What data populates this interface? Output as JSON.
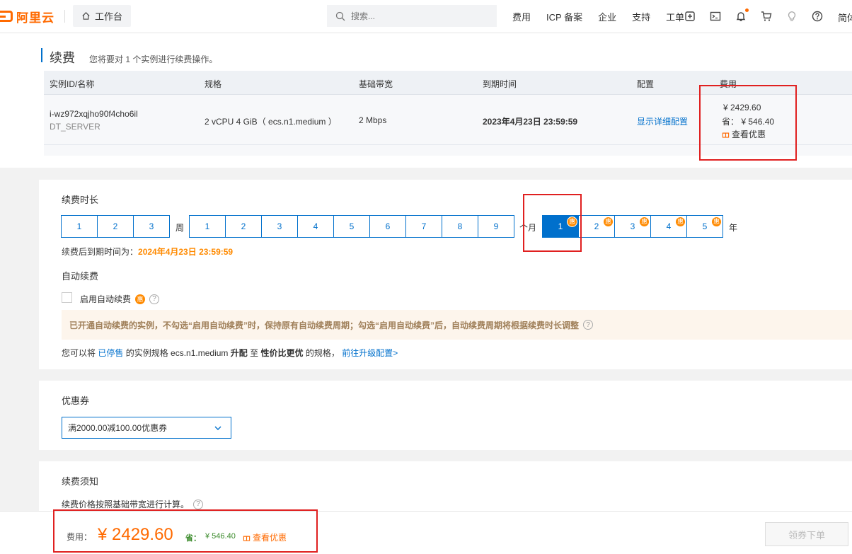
{
  "header": {
    "brand": "阿里云",
    "workbench": "工作台",
    "search_placeholder": "搜索...",
    "nav": [
      "费用",
      "ICP 备案",
      "企业",
      "支持",
      "工单"
    ],
    "trail": "简体"
  },
  "renew": {
    "title": "续费",
    "subtitle": "您将要对 1 个实例进行续费操作。",
    "columns": [
      "实例ID/名称",
      "规格",
      "基础带宽",
      "到期时间",
      "配置",
      "费用"
    ],
    "row": {
      "instance_id": "i-wz972xqjho90f4cho6il",
      "instance_name": "DT_SERVER",
      "spec": "2 vCPU 4 GiB（ ecs.n1.medium ）",
      "bandwidth": "2 Mbps",
      "expire": "2023年4月23日 23:59:59",
      "config_link": "显示详细配置",
      "fee": "¥ 2429.60",
      "save": "省：  ¥ 546.40",
      "discount_link": "查看优惠"
    }
  },
  "duration": {
    "title": "续费时长",
    "weeks": [
      "1",
      "2",
      "3"
    ],
    "week_unit": "周",
    "months": [
      "1",
      "2",
      "3",
      "4",
      "5",
      "6",
      "7",
      "8",
      "9"
    ],
    "month_unit": "个月",
    "years": [
      "1",
      "2",
      "3",
      "4",
      "5"
    ],
    "year_unit": "年",
    "selected": "年-1",
    "hui_badge": "惠",
    "expire_after_label": "续费后到期时间为：",
    "expire_after_value": "2024年4月23日 23:59:59"
  },
  "autorenew": {
    "title": "自动续费",
    "checkbox_label": "启用自动续费",
    "checked": false,
    "notice": "已开通自动续费的实例，不勾选“启用自动续费”时，保持原有自动续费周期；勾选“启用自动续费”后，自动续费周期将根据续费时长调整",
    "upgrade_p1": "您可以将",
    "upgrade_stopped": "已停售",
    "upgrade_p2": "的实例规格 ecs.n1.medium",
    "upgrade_bold1": "升配",
    "upgrade_p3": "至",
    "upgrade_bold2": "性价比更优",
    "upgrade_p4": "的规格，",
    "upgrade_link": "前往升级配置>"
  },
  "coupon": {
    "title": "优惠券",
    "selected": "满2000.00减100.00优惠券"
  },
  "notice_section": {
    "title": "续费须知",
    "text": "续费价格按照基础带宽进行计算。"
  },
  "footer": {
    "fee_label": "费用：",
    "fee_value": "¥ 2429.60",
    "save_label": "省：",
    "save_value": "¥ 546.40",
    "discount_link": "查看优惠",
    "order_button": "领券下单"
  },
  "colors": {
    "brand": "#ff6a00",
    "link": "#0070cc",
    "price": "#ff6a00",
    "save": "#3a8a2a",
    "highlight_box": "#e02020"
  }
}
